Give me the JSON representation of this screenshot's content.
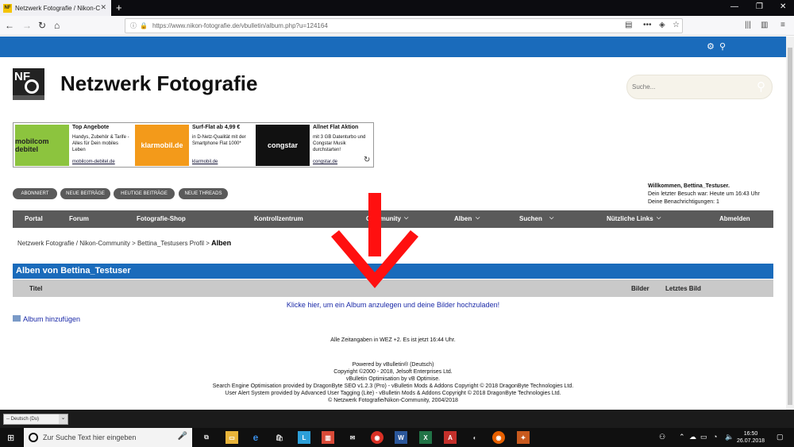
{
  "browser": {
    "tab_title": "Netzwerk Fotografie / Nikon-C",
    "tab_favicon": "NF",
    "url": "https://www.nikon-fotografie.de/vbulletin/album.php?u=124164"
  },
  "site": {
    "title": "Netzwerk Fotografie",
    "search_placeholder": "Suche..."
  },
  "ads": [
    {
      "title": "Top Angebote",
      "desc": "Handys, Zubehör & Tarife - Alles für Dein mobiles Leben",
      "link": "mobilcom-debitel.de",
      "brand": "mobilcom debitel",
      "color": "#8cc43e"
    },
    {
      "title": "Surf-Flat ab 4,99 €",
      "desc": "in D-Netz-Qualität mit der Smartphone Flat 1000*",
      "link": "klarmobil.de",
      "brand": "klarmobil.de",
      "color": "#f39a1a"
    },
    {
      "title": "Allnet Flat Aktion",
      "desc": "mit 3 GB Datenturbo und Congstar Musik durchstarten!",
      "link": "congstar.de",
      "brand": "congstar",
      "color": "#111111"
    }
  ],
  "quick_buttons": [
    "ABONNIERT",
    "NEUE BEITRÄGE",
    "HEUTIGE BEITRÄGE",
    "NEUE THREADS"
  ],
  "welcome": {
    "line1": "Willkommen, Bettina_Testuser.",
    "line2": "Dein letzter Besuch war: Heute um 16:43 Uhr",
    "line3": "Deine Benachrichtigungen: 1"
  },
  "nav": [
    "Portal",
    "Forum",
    "Fotografie-Shop",
    "Kontrollzentrum",
    "Community",
    "Alben",
    "Suchen",
    "Nützliche Links",
    "Abmelden"
  ],
  "breadcrumb": {
    "item1": "Netzwerk Fotografie / Nikon-Community",
    "item2": "Bettina_Testusers Profil",
    "current": "Alben"
  },
  "albums": {
    "heading": "Alben von Bettina_Testuser",
    "col_title": "Titel",
    "col_images": "Bilder",
    "col_last": "Letztes Bild",
    "empty_message": "Klicke hier, um ein Album anzulegen und deine Bilder hochzuladen!",
    "add_album": "Album hinzufügen"
  },
  "timezone": "Alle Zeitangaben in WEZ +2. Es ist jetzt 16:44 Uhr.",
  "footer": [
    "Powered by vBulletin® (Deutsch)",
    "Copyright ©2000 - 2018, Jelsoft Enterprises Ltd.",
    "vBulletin Optimisation by vB Optimise.",
    "Search Engine Optimisation provided by DragonByte SEO v1.2.3 (Pro) - vBulletin Mods & Addons Copyright © 2018 DragonByte Technologies Ltd.",
    "User Alert System provided by Advanced User Tagging (Lite) - vBulletin Mods & Addons Copyright © 2018 DragonByte Technologies Ltd.",
    "© Netzwerk Fotografie/Nikon-Community, 2004/2018"
  ],
  "language_select": "-- Deutsch (Du)",
  "taskbar": {
    "search_placeholder": "Zur Suche Text hier eingeben",
    "time": "16:50",
    "date": "26.07.2018"
  },
  "colors": {
    "brand_blue": "#1a6bbb",
    "nav_gray": "#5a5a5a",
    "arrow_red": "#ff1010"
  }
}
